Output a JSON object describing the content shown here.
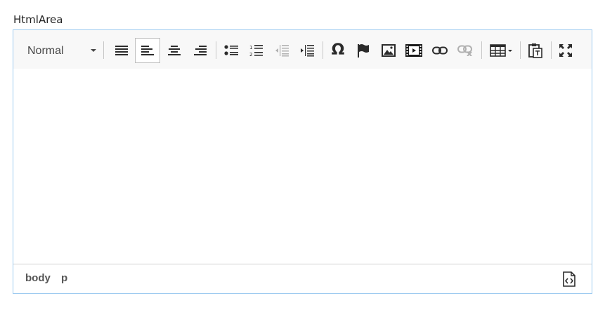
{
  "field": {
    "label": "HtmlArea"
  },
  "toolbar": {
    "format": {
      "selected": "Normal"
    },
    "buttons": [
      {
        "name": "justify-block",
        "icon": "align-justify-icon"
      },
      {
        "name": "align-left",
        "icon": "align-left-icon",
        "active": true
      },
      {
        "name": "align-center",
        "icon": "align-center-icon"
      },
      {
        "name": "align-right",
        "icon": "align-right-icon"
      },
      {
        "name": "bulleted-list",
        "icon": "bulleted-list-icon"
      },
      {
        "name": "numbered-list",
        "icon": "numbered-list-icon"
      },
      {
        "name": "outdent",
        "icon": "outdent-icon",
        "disabled": true
      },
      {
        "name": "indent",
        "icon": "indent-icon"
      },
      {
        "name": "special-char",
        "icon": "omega-icon",
        "glyph": "Ω"
      },
      {
        "name": "anchor",
        "icon": "flag-icon"
      },
      {
        "name": "image",
        "icon": "image-icon"
      },
      {
        "name": "video",
        "icon": "film-icon"
      },
      {
        "name": "link",
        "icon": "link-icon"
      },
      {
        "name": "unlink",
        "icon": "unlink-icon",
        "disabled": true
      },
      {
        "name": "table",
        "icon": "table-icon"
      },
      {
        "name": "paste-text",
        "icon": "paste-text-icon"
      },
      {
        "name": "fullscreen",
        "icon": "fullscreen-icon"
      }
    ]
  },
  "status_bar": {
    "path": [
      "body",
      "p"
    ],
    "source_icon": "source-code-icon"
  },
  "colors": {
    "border_focus": "#9ecbf0",
    "toolbar_bg": "#f8f8f8",
    "icon": "#2b2b2b",
    "icon_disabled": "#b0b0b0"
  }
}
